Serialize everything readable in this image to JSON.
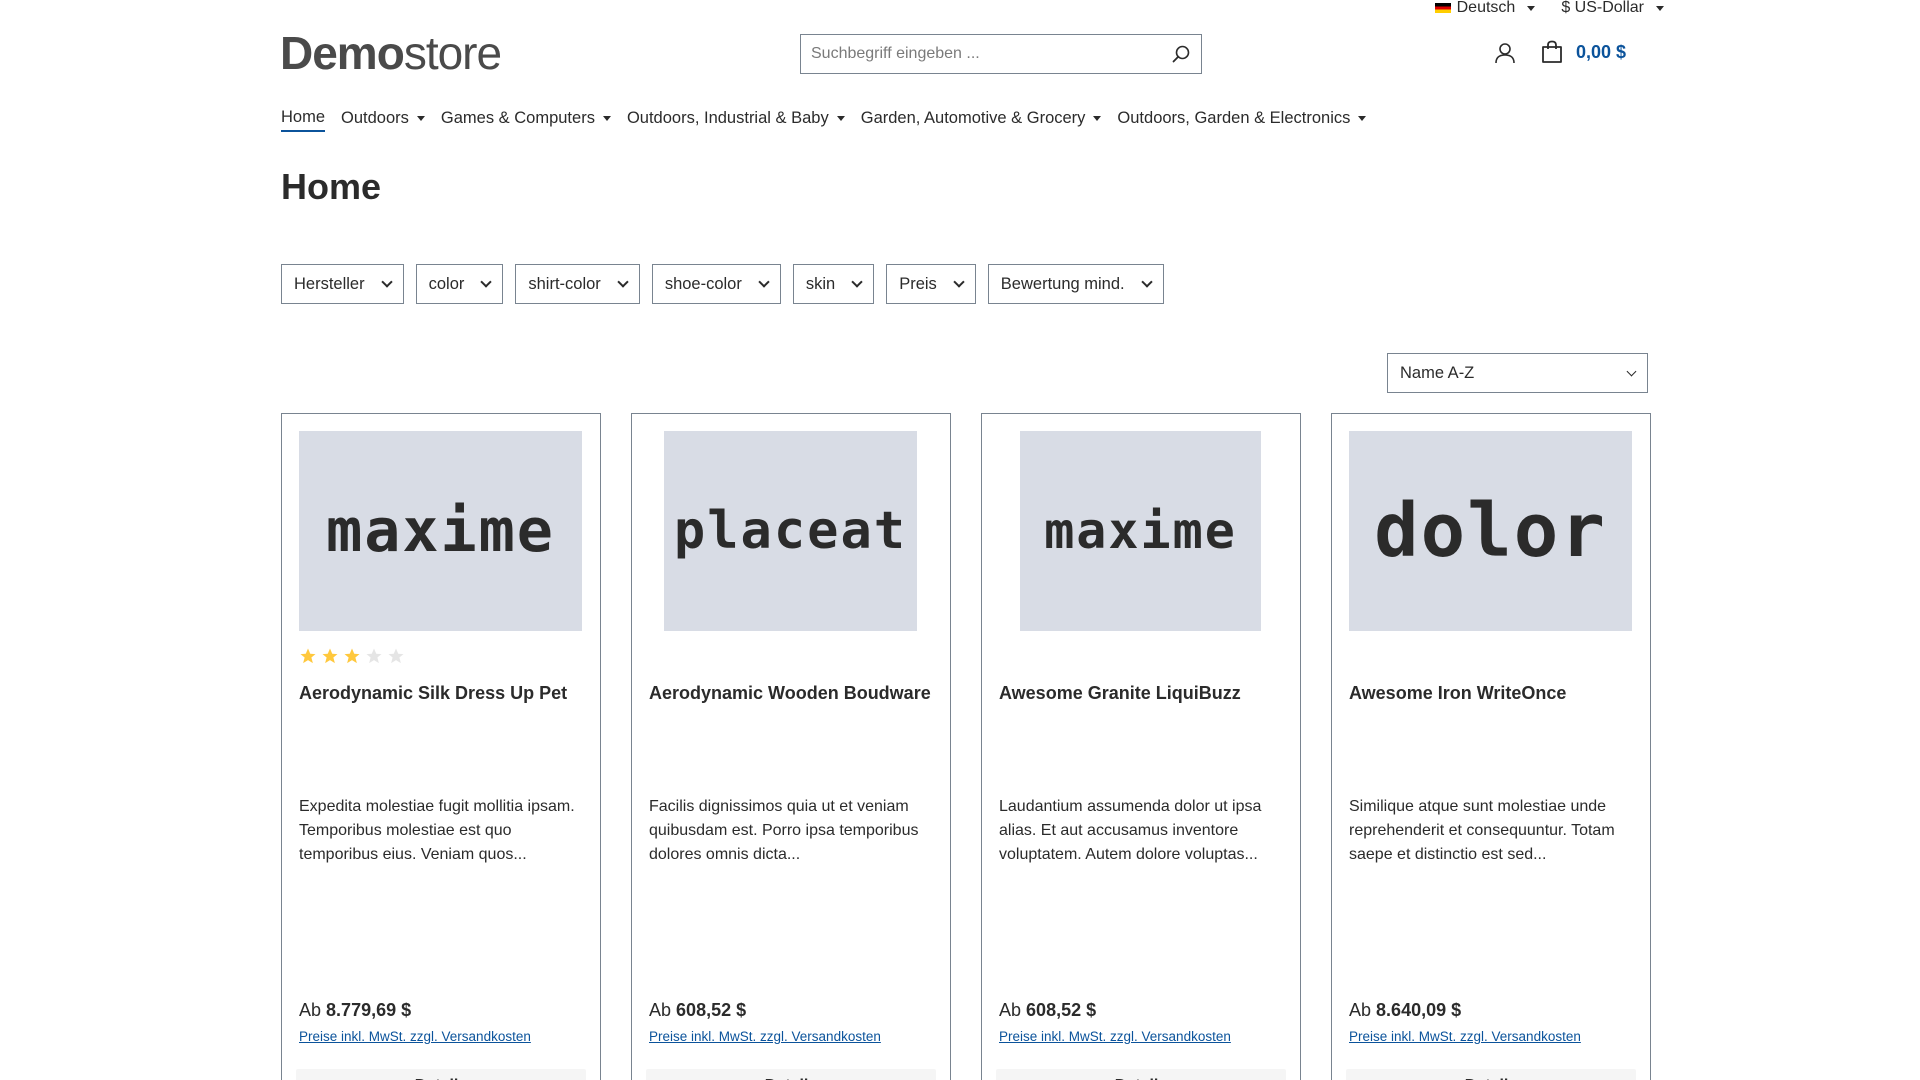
{
  "topbar": {
    "language": "Deutsch",
    "currency": "$ US-Dollar"
  },
  "header": {
    "logo_bold": "Demo",
    "logo_thin": "store",
    "search_placeholder": "Suchbegriff eingeben ...",
    "cart_total": "0,00 $"
  },
  "nav": {
    "items": [
      {
        "label": "Home"
      },
      {
        "label": "Outdoors"
      },
      {
        "label": "Games & Computers"
      },
      {
        "label": "Outdoors, Industrial & Baby"
      },
      {
        "label": "Garden, Automotive & Grocery"
      },
      {
        "label": "Outdoors, Garden & Electronics"
      }
    ]
  },
  "page_title": "Home",
  "filters": [
    {
      "label": "Hersteller"
    },
    {
      "label": "color"
    },
    {
      "label": "shirt-color"
    },
    {
      "label": "shoe-color"
    },
    {
      "label": "skin"
    },
    {
      "label": "Preis"
    },
    {
      "label": "Bewertung mind."
    }
  ],
  "sort": {
    "selected": "Name A-Z"
  },
  "products": [
    {
      "image_text": "maxime",
      "rating": 3,
      "rating_max": 5,
      "name": "Aerodynamic Silk Dress Up Pet",
      "description": "Expedita molestiae fugit mollitia ipsam. Temporibus molestiae est quo temporibus eius. Veniam quos...",
      "price_prefix": "Ab",
      "price": "8.779,69 $",
      "tax_note": "Preise inkl. MwSt. zzgl. Versandkosten",
      "details_label": "Details"
    },
    {
      "image_text": "placeat",
      "name": "Aerodynamic Wooden Boudware",
      "description": "Facilis dignissimos quia ut et veniam quibusdam est. Porro ipsa temporibus dolores omnis dicta...",
      "price_prefix": "Ab",
      "price": "608,52 $",
      "tax_note": "Preise inkl. MwSt. zzgl. Versandkosten",
      "details_label": "Details"
    },
    {
      "image_text": "maxime",
      "name": "Awesome Granite LiquiBuzz",
      "description": "Laudantium assumenda dolor ut ipsa alias. Et aut accusamus inventore voluptatem. Autem dolore voluptas...",
      "price_prefix": "Ab",
      "price": "608,52 $",
      "tax_note": "Preise inkl. MwSt. zzgl. Versandkosten",
      "details_label": "Details"
    },
    {
      "image_text": "dolor",
      "name": "Awesome Iron WriteOnce",
      "description": "Similique atque sunt molestiae unde reprehenderit et consequuntur. Totam saepe et distinctio est sed...",
      "price_prefix": "Ab",
      "price": "8.640,09 $",
      "tax_note": "Preise inkl. MwSt. zzgl. Versandkosten",
      "details_label": "Details"
    }
  ],
  "colors": {
    "accent": "#0b539b",
    "star": "#ffc83d",
    "star_empty": "#e5e5e5",
    "thumb_bg": "#d8dce5",
    "border": "#798490"
  },
  "icons": {
    "search": "search-icon",
    "account": "user-icon",
    "cart": "shopping-bag-icon",
    "flag": "german-flag-icon"
  }
}
